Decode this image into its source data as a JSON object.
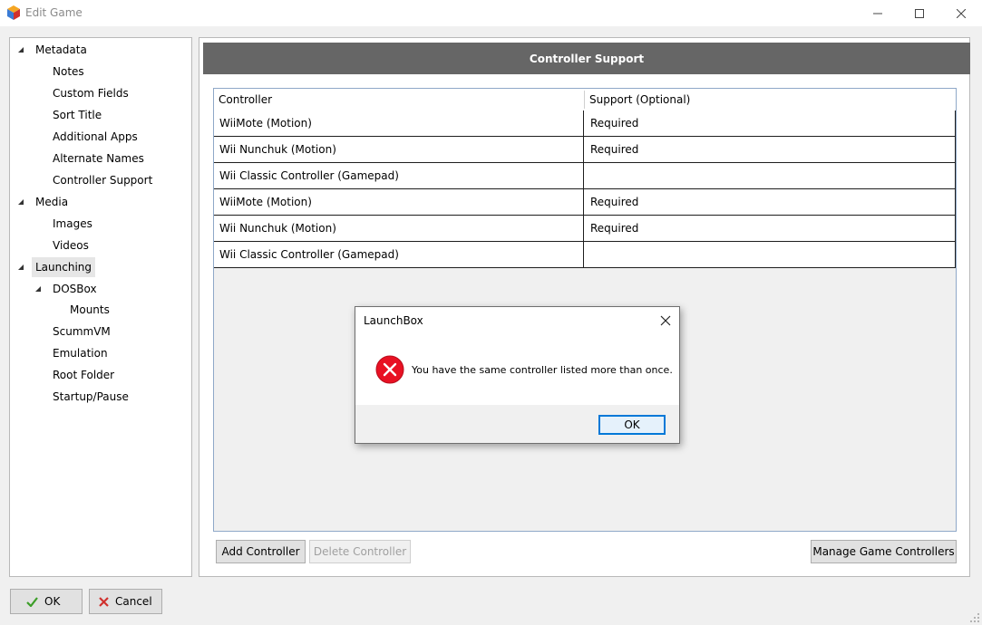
{
  "window": {
    "title": "Edit Game",
    "icon": "launchbox-cube-icon"
  },
  "tree": {
    "items": [
      {
        "label": "Metadata",
        "expanded": true
      },
      {
        "label": "Notes"
      },
      {
        "label": "Custom Fields"
      },
      {
        "label": "Sort Title"
      },
      {
        "label": "Additional Apps"
      },
      {
        "label": "Alternate Names"
      },
      {
        "label": "Controller Support"
      },
      {
        "label": "Media",
        "expanded": true
      },
      {
        "label": "Images"
      },
      {
        "label": "Videos"
      },
      {
        "label": "Launching",
        "expanded": true,
        "selected": true
      },
      {
        "label": "DOSBox",
        "expanded": true
      },
      {
        "label": "Mounts"
      },
      {
        "label": "ScummVM"
      },
      {
        "label": "Emulation"
      },
      {
        "label": "Root Folder"
      },
      {
        "label": "Startup/Pause"
      }
    ]
  },
  "panel": {
    "header": "Controller Support",
    "columns": [
      "Controller",
      "Support (Optional)"
    ],
    "rows": [
      {
        "controller": "WiiMote (Motion)",
        "support": "Required"
      },
      {
        "controller": "Wii Nunchuk (Motion)",
        "support": "Required"
      },
      {
        "controller": "Wii Classic Controller (Gamepad)",
        "support": ""
      },
      {
        "controller": "WiiMote (Motion)",
        "support": "Required"
      },
      {
        "controller": "Wii Nunchuk (Motion)",
        "support": "Required"
      },
      {
        "controller": "Wii Classic Controller (Gamepad)",
        "support": ""
      }
    ],
    "add_button": "Add Controller",
    "delete_button": "Delete Controller",
    "manage_button": "Manage Game Controllers"
  },
  "dialog": {
    "title": "LaunchBox",
    "message": "You have the same controller listed more than once.",
    "ok": "OK",
    "icon": "error-icon",
    "icon_color": "#e81123"
  },
  "footer": {
    "ok": "OK",
    "cancel": "Cancel",
    "ok_icon_color": "#3c9e28",
    "cancel_icon_color": "#d0312d"
  }
}
